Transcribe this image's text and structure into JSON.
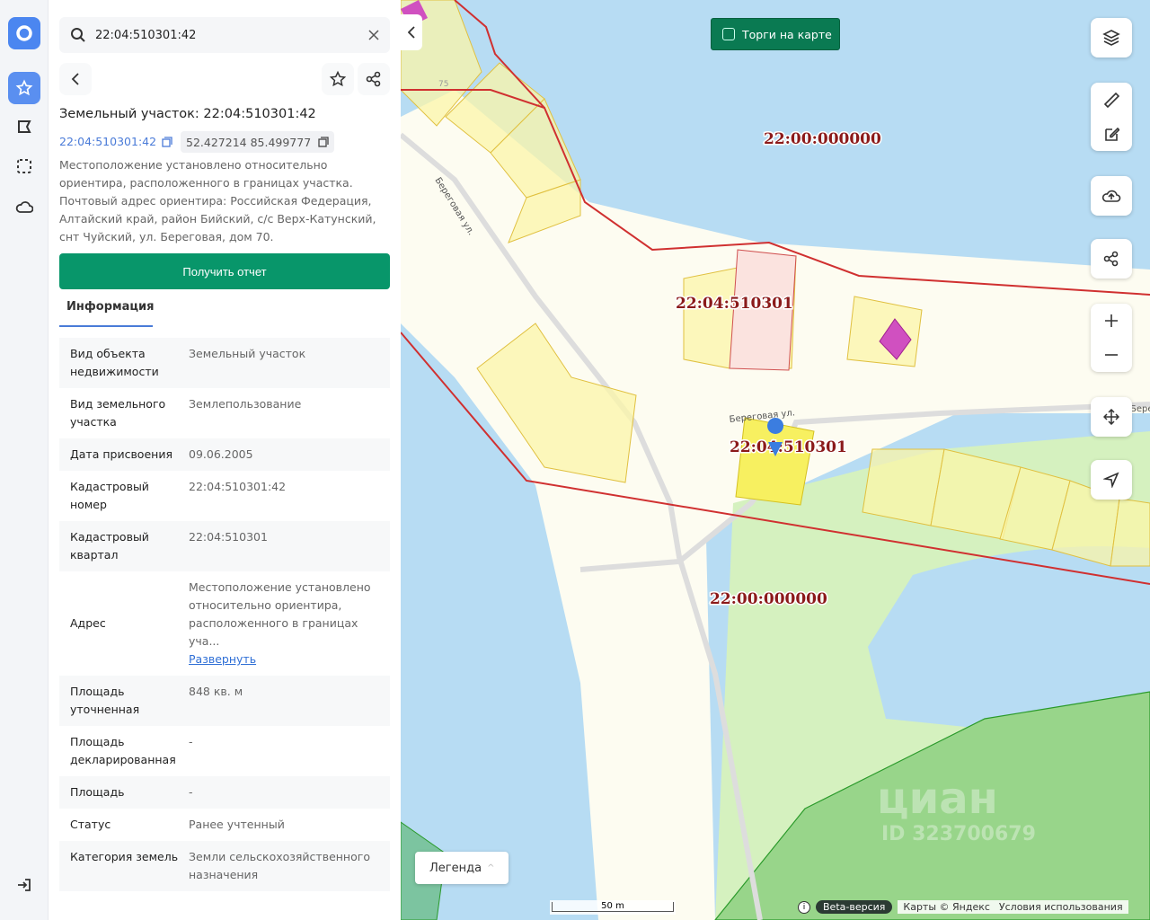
{
  "search": {
    "value": "22:04:510301:42"
  },
  "object": {
    "title": "Земельный участок: 22:04:510301:42",
    "cadastral_number": "22:04:510301:42",
    "coordinates": "52.427214 85.499777",
    "description": "Местоположение установлено относительно ориентира, расположенного в границах участка. Почтовый адрес ориентира: Российская Федерация, Алтайский край, район Бийский, с/с Верх-Катунский, снт Чуйский, ул. Береговая, дом 70."
  },
  "report_button": "Получить отчет",
  "tab": "Информация",
  "info": [
    {
      "key": "Вид объекта недвижимости",
      "value": "Земельный участок"
    },
    {
      "key": "Вид земельного участка",
      "value": "Землепользование"
    },
    {
      "key": "Дата присвоения",
      "value": "09.06.2005"
    },
    {
      "key": "Кадастровый номер",
      "value": "22:04:510301:42"
    },
    {
      "key": "Кадастровый квартал",
      "value": "22:04:510301"
    },
    {
      "key": "Адрес",
      "value": "Местоположение установлено относительно ориентира, расположенного в границах уча...",
      "link": "Развернуть"
    },
    {
      "key": "Площадь уточненная",
      "value": "848 кв. м"
    },
    {
      "key": "Площадь декларированная",
      "value": "-"
    },
    {
      "key": "Площадь",
      "value": "-"
    },
    {
      "key": "Статус",
      "value": "Ранее учтенный"
    },
    {
      "key": "Категория земель",
      "value": "Земли сельскохозяйственного назначения"
    }
  ],
  "map": {
    "torgi": "Торги на карте",
    "labels": [
      "22:00:000000",
      "22:04:510301",
      "22:04:510301",
      "22:00:000000"
    ],
    "streets": [
      "Береговая ул.",
      "Береговая ул.",
      "Бере"
    ],
    "house_number": "75",
    "legend": "Легенда",
    "scale": "50 m",
    "beta": "Beta-версия",
    "attribution": "Карты © Яндекс",
    "terms": "Условия использования",
    "watermark": "циан",
    "watermark_id": "ID 323700679"
  },
  "colors": {
    "accent": "#4a7bd8",
    "report": "#08966a",
    "boundary": "#d03030"
  }
}
